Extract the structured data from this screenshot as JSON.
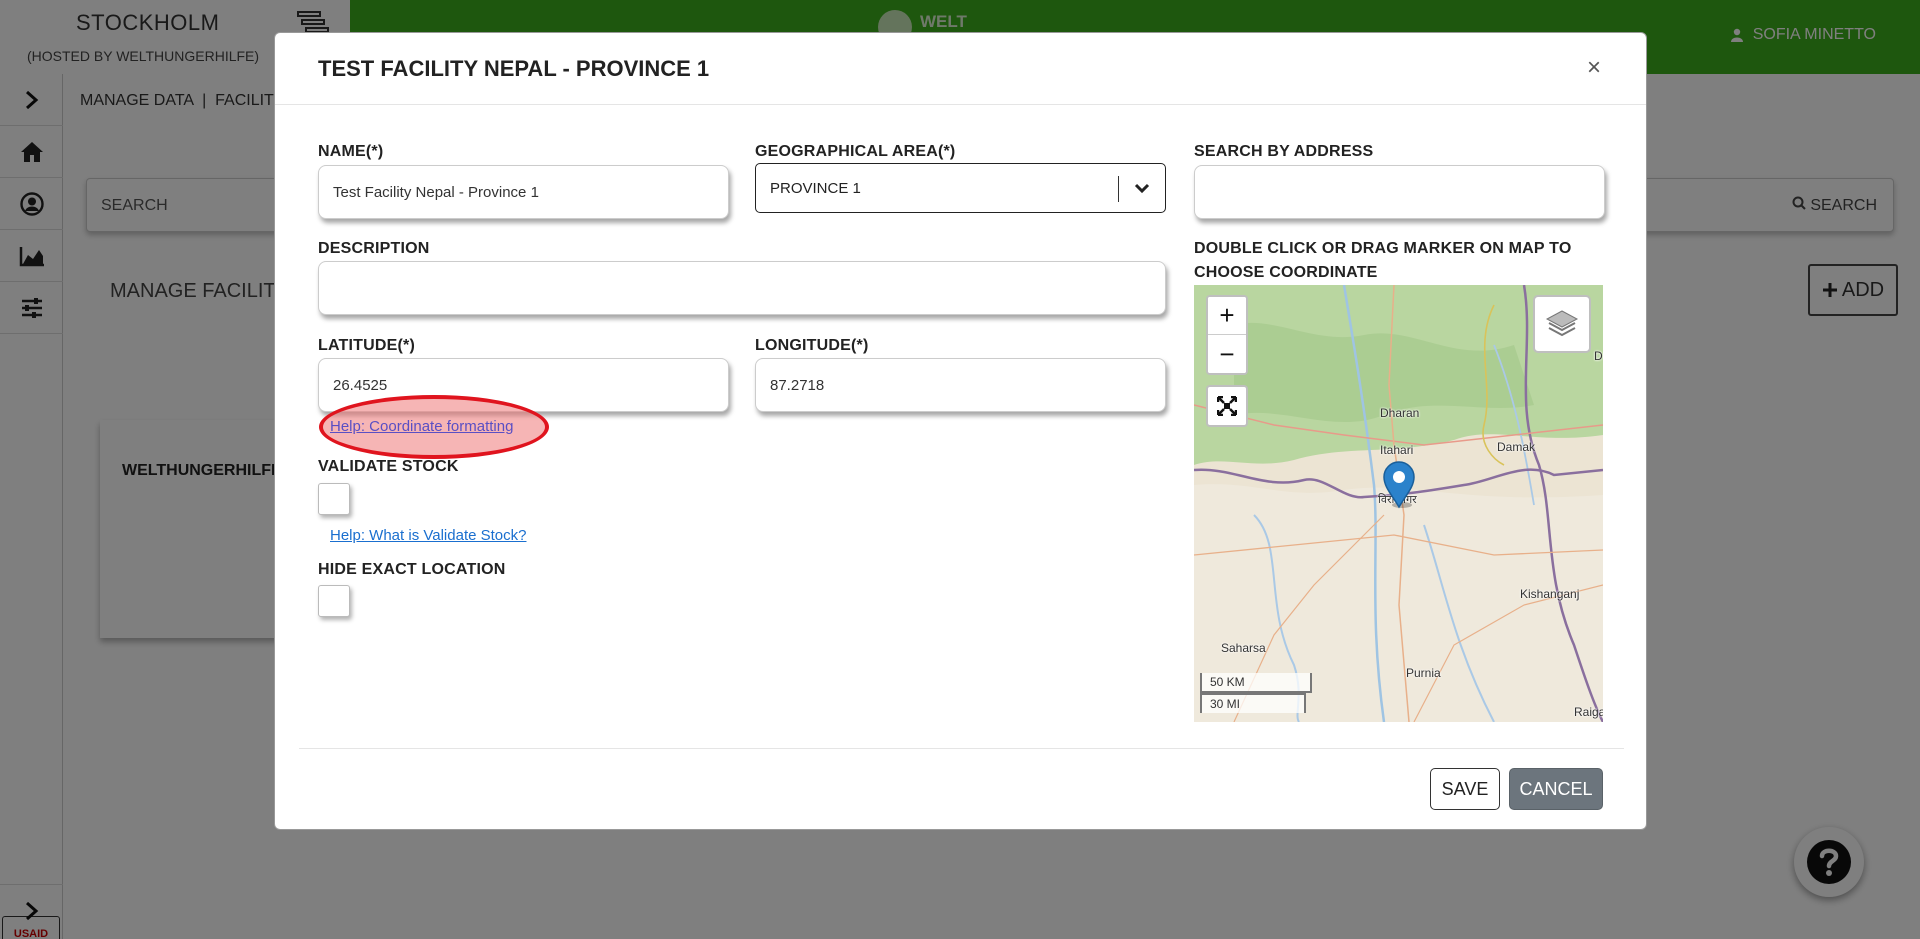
{
  "app": {
    "org_title": "STOCKHOLM",
    "org_subtitle": "(HOSTED BY WELTHUNGERHILFE)",
    "logo_text": "WELT",
    "user_name": "SOFIA MINETTO",
    "accent_color": "#3dae1c"
  },
  "background": {
    "breadcrumb": "MANAGE DATA  |  FACILITIE",
    "search_placeholder": "SEARCH",
    "search_button": "SEARCH",
    "manage_title": "MANAGE FACILITIE",
    "add_button": "ADD",
    "card_title": "WELTHUNGERHILFE",
    "usaid_logo": "USAID"
  },
  "modal": {
    "title": "TEST FACILITY NEPAL - PROVINCE 1",
    "close_label": "×",
    "name": {
      "label": "NAME(*)",
      "value": "Test Facility Nepal - Province 1"
    },
    "geo_area": {
      "label": "GEOGRAPHICAL AREA(*)",
      "value": "PROVINCE 1"
    },
    "search_address": {
      "label": "SEARCH BY ADDRESS",
      "value": ""
    },
    "description": {
      "label": "DESCRIPTION",
      "value": ""
    },
    "latitude": {
      "label": "LATITUDE(*)",
      "value": "26.4525"
    },
    "longitude": {
      "label": "LONGITUDE(*)",
      "value": "87.2718"
    },
    "coord_help_link": "Help: Coordinate formatting",
    "validate_stock": {
      "label": "VALIDATE STOCK",
      "checked": false,
      "help_link": "Help: What is Validate Stock?"
    },
    "hide_location": {
      "label": "HIDE EXACT LOCATION",
      "checked": false
    },
    "map": {
      "label_line1": "DOUBLE CLICK OR DRAG MARKER ON MAP TO",
      "label_line2": "CHOOSE COORDINATE",
      "zoom_in": "+",
      "zoom_out": "−",
      "places": {
        "dharan": "Dharan",
        "itahari": "Itahari",
        "damak": "Damak",
        "biratnagar": "विराटनगर",
        "kishanganj": "Kishanganj",
        "saharsa": "Saharsa",
        "purnia": "Purnia",
        "raiga": "Raiga",
        "edge_d": "D"
      },
      "scale_km": "50 KM",
      "scale_mi": "30 MI"
    },
    "save_button": "SAVE",
    "cancel_button": "CANCEL"
  }
}
